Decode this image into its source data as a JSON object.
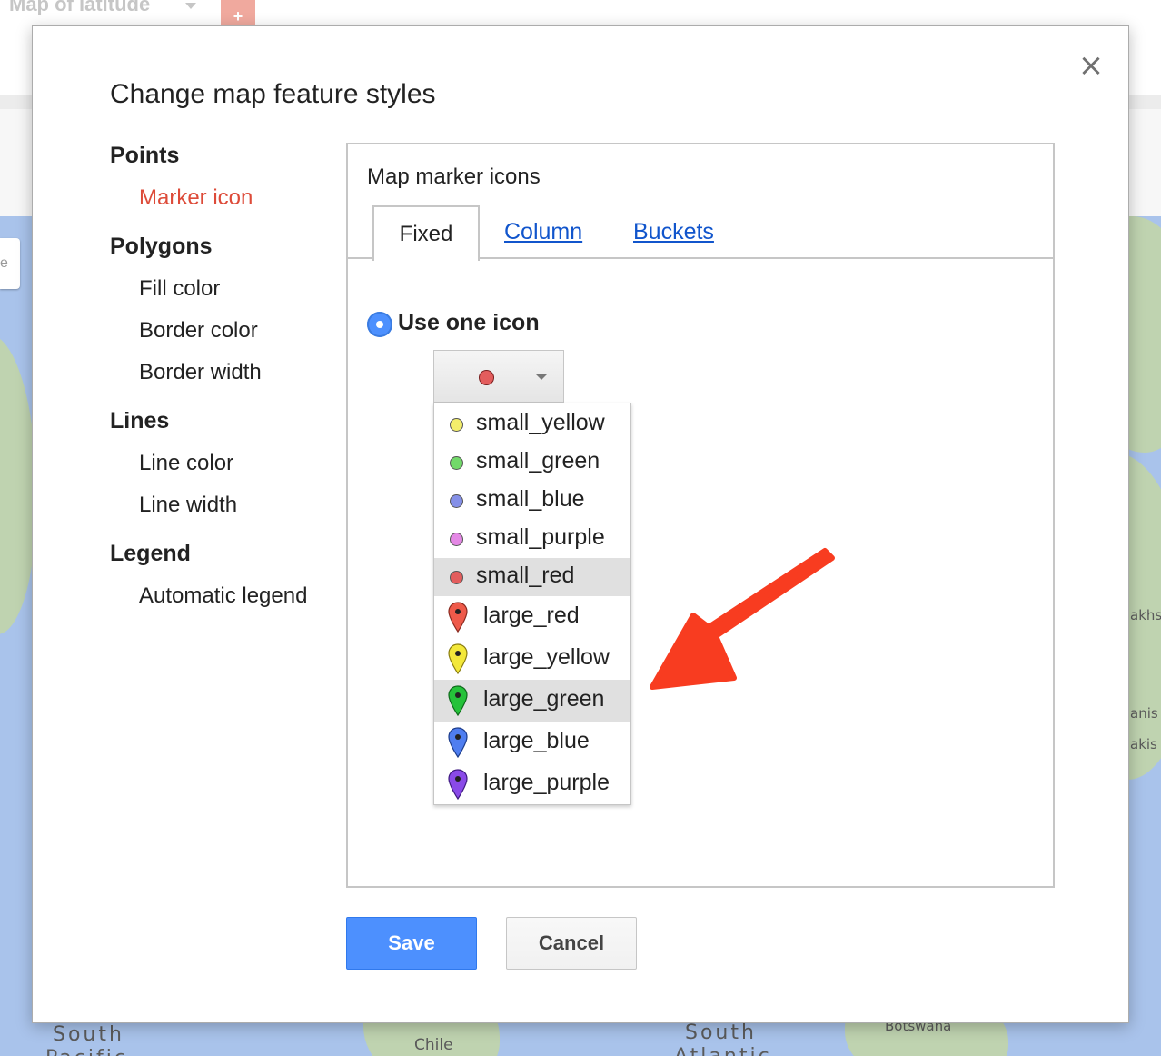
{
  "app": {
    "title": "Map of latitude",
    "add_tab_label": "+"
  },
  "map": {
    "labels": [
      "South",
      "Pacific",
      "Chile",
      "South",
      "Atlantic",
      "Botswana",
      "akhs",
      "anis",
      "akis",
      "e"
    ]
  },
  "dialog": {
    "title": "Change map feature styles",
    "close_label": "×",
    "nav": {
      "points": {
        "label": "Points",
        "items": [
          "Marker icon"
        ]
      },
      "polygons": {
        "label": "Polygons",
        "items": [
          "Fill color",
          "Border color",
          "Border width"
        ]
      },
      "lines": {
        "label": "Lines",
        "items": [
          "Line color",
          "Line width"
        ]
      },
      "legend": {
        "label": "Legend",
        "items": [
          "Automatic legend"
        ]
      },
      "active_item": "Marker icon",
      "active_color": "#dd4b39"
    },
    "panel": {
      "title": "Map marker icons",
      "tabs": [
        "Fixed",
        "Column",
        "Buckets"
      ],
      "active_tab": "Fixed",
      "radio_label": "Use one icon",
      "selected_icon": "small_red",
      "options": [
        {
          "label": "small_yellow",
          "icon": "small-dot-icon",
          "color": "#f3ee6b"
        },
        {
          "label": "small_green",
          "icon": "small-dot-icon",
          "color": "#72d96a"
        },
        {
          "label": "small_blue",
          "icon": "small-dot-icon",
          "color": "#8590e8"
        },
        {
          "label": "small_purple",
          "icon": "small-dot-icon",
          "color": "#e488e5"
        },
        {
          "label": "small_red",
          "icon": "small-dot-icon",
          "color": "#e35d5d"
        },
        {
          "label": "large_red",
          "icon": "map-pin-icon",
          "color": "#ee5a4a"
        },
        {
          "label": "large_yellow",
          "icon": "map-pin-icon",
          "color": "#f3e83a"
        },
        {
          "label": "large_green",
          "icon": "map-pin-icon",
          "color": "#25c23a"
        },
        {
          "label": "large_blue",
          "icon": "map-pin-icon",
          "color": "#4f7ef0"
        },
        {
          "label": "large_purple",
          "icon": "map-pin-icon",
          "color": "#8a4ae8"
        }
      ],
      "highlighted": [
        "small_red",
        "large_green"
      ]
    },
    "buttons": {
      "save": "Save",
      "cancel": "Cancel"
    }
  },
  "annotation": {
    "type": "arrow-icon",
    "color": "#f83c20"
  }
}
